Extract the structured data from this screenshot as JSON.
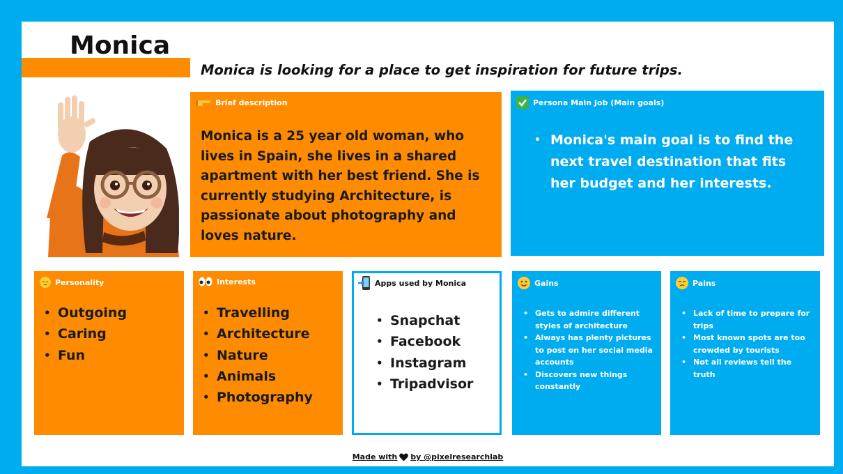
{
  "persona": {
    "name": "Monica",
    "tagline": "Monica is looking for a place to get inspiration for future trips."
  },
  "brief_description": {
    "title": "Brief description",
    "icon": "pointing-hand-icon",
    "text": "Monica is a 25 year old woman, who lives in Spain, she lives in a shared apartment with her best friend. She is currently studying Architecture, is passionate about photography and loves nature."
  },
  "main_job": {
    "title": "Persona Main Job (Main goals)",
    "icon": "check-mark-icon",
    "items": [
      "Monica's main goal is to find the next travel destination that fits her budget and her interests."
    ]
  },
  "personality": {
    "title": "Personality",
    "icon": "relieved-face-icon",
    "items": [
      "Outgoing",
      "Caring",
      "Fun"
    ]
  },
  "interests": {
    "title": "Interests",
    "icon": "eyes-icon",
    "items": [
      "Travelling",
      "Architecture",
      "Nature",
      "Animals",
      "Photography"
    ]
  },
  "apps": {
    "title": "Apps used by Monica",
    "icon": "mobile-phone-arrow-icon",
    "items": [
      "Snapchat",
      "Facebook",
      "Instagram",
      "Tripadvisor"
    ]
  },
  "gains": {
    "title": "Gains",
    "icon": "smiling-face-icon",
    "items": [
      "Gets to admire different styles of architecture",
      "Always has plenty pictures to post on her social media accounts",
      "Discovers new things constantly"
    ]
  },
  "pains": {
    "title": "Pains",
    "icon": "sad-face-icon",
    "items": [
      "Lack of time to prepare for trips",
      "Most known spots are too crowded by tourists",
      "Not all reviews tell the truth"
    ]
  },
  "footer": {
    "before": "Made with",
    "icon": "black-heart-icon",
    "after": "by @pixelresearchlab"
  },
  "colors": {
    "orange": "#ff8c00",
    "blue": "#00acf0",
    "white": "#ffffff",
    "text_dark": "#1a1a1a"
  }
}
